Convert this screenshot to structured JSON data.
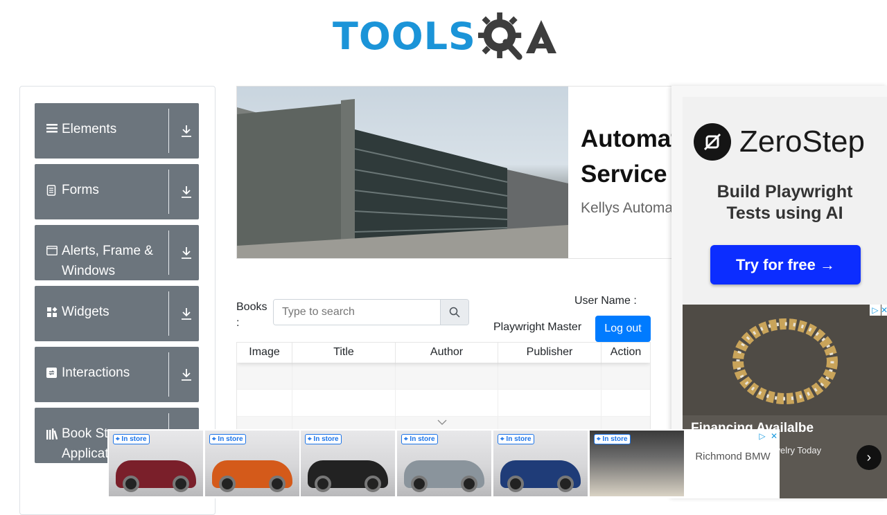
{
  "logo": {
    "tools": "TOOLS",
    "qa": "QA"
  },
  "sidebar": {
    "groups": [
      {
        "label": "Elements",
        "icon": "menu-icon"
      },
      {
        "label": "Forms",
        "icon": "document-icon"
      },
      {
        "label": "Alerts, Frame & Windows",
        "icon": "window-icon"
      },
      {
        "label": "Widgets",
        "icon": "widgets-icon"
      },
      {
        "label": "Interactions",
        "icon": "interactions-icon"
      },
      {
        "label": "Book Store Application",
        "icon": "library-icon"
      }
    ]
  },
  "banner": {
    "title_line1": "Automatic Gate",
    "title_line2": "Service",
    "subtitle": "Kellys Automatic Gates"
  },
  "books": {
    "label": "Books :",
    "search_placeholder": "Type to search",
    "user_label": "User Name :",
    "user_name": "Playwright Master",
    "logout": "Log out"
  },
  "table": {
    "columns": [
      "Image",
      "Title",
      "Author",
      "Publisher",
      "Action"
    ]
  },
  "ad_right": {
    "brand": "ZeroStep",
    "headline_1": "Build Playwright",
    "headline_2": "Tests using AI",
    "cta": "Try for free →",
    "jewel_title": "Financing Availalbe",
    "jewel_sub": "r Jewelry Today"
  },
  "bottom_ad": {
    "tags": [
      "In store",
      "In store",
      "In store",
      "In store",
      "In store",
      "In store"
    ],
    "dealer": "Richmond BMW"
  },
  "colors": {
    "sidebar_bg": "#6c757d",
    "primary": "#007bff",
    "logo_blue": "#1b94d8",
    "cta_blue": "#0c2dff"
  }
}
